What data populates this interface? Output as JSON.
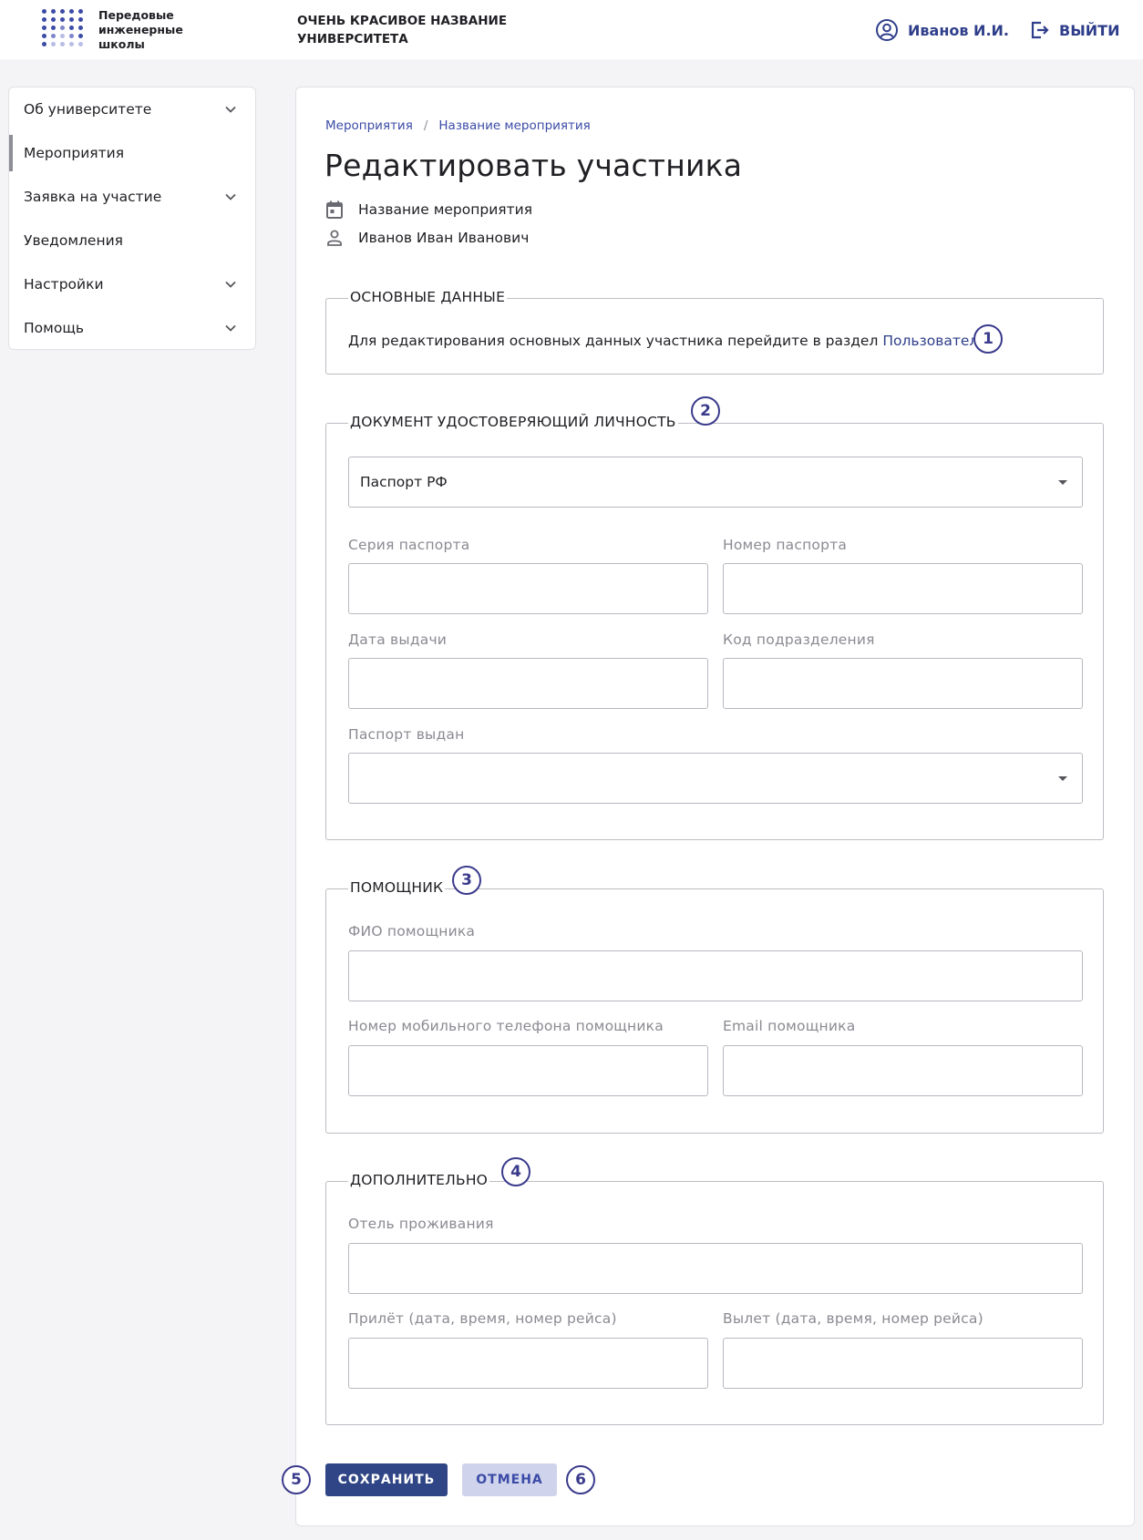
{
  "header": {
    "logo_lines": [
      "Передовые",
      "инженерные",
      "школы"
    ],
    "university_lines": [
      "ОЧЕНЬ КРАСИВОЕ НАЗВАНИЕ",
      "УНИВЕРСИТЕТА"
    ],
    "user_name": "Иванов И.И.",
    "logout_label": "ВЫЙТИ"
  },
  "sidebar": {
    "items": [
      {
        "label": "Об университете",
        "has_children": true
      },
      {
        "label": "Мероприятия",
        "has_children": false,
        "active": true
      },
      {
        "label": "Заявка на участие",
        "has_children": true
      },
      {
        "label": "Уведомления",
        "has_children": false
      },
      {
        "label": "Настройки",
        "has_children": true
      },
      {
        "label": "Помощь",
        "has_children": true
      }
    ]
  },
  "breadcrumb": [
    "Мероприятия",
    "Название мероприятия"
  ],
  "page": {
    "title": "Редактировать участника",
    "event_name": "Название мероприятия",
    "participant_name": "Иванов Иван Иванович"
  },
  "sections": {
    "basic": {
      "legend": "ОСНОВНЫЕ ДАННЫЕ",
      "text": "Для редактирования основных данных участника перейдите в раздел",
      "link": "Пользователи",
      "badge": "1"
    },
    "document": {
      "legend": "ДОКУМЕНТ УДОСТОВЕРЯЮЩИЙ ЛИЧНОСТЬ",
      "badge": "2",
      "doc_type_value": "Паспорт РФ",
      "series_label": "Серия паспорта",
      "number_label": "Номер паспорта",
      "issue_date_label": "Дата выдачи",
      "dept_code_label": "Код подразделения",
      "issued_by_label": "Паспорт выдан"
    },
    "assistant": {
      "legend": "ПОМОЩНИК",
      "badge": "3",
      "name_label": "ФИО помощника",
      "phone_label": "Номер мобильного телефона помощника",
      "email_label": "Email помощника"
    },
    "extra": {
      "legend": "ДОПОЛНИТЕЛЬНО",
      "badge": "4",
      "hotel_label": "Отель проживания",
      "arrival_label": "Прилёт (дата, время, номер рейса)",
      "departure_label": "Вылет (дата, время, номер рейса)"
    }
  },
  "actions": {
    "save_label": "СОХРАНИТЬ",
    "cancel_label": "ОТМЕНА",
    "save_badge": "5",
    "cancel_badge": "6"
  },
  "colors": {
    "accent": "#2f3e8a",
    "primary_button": "#2f4585",
    "secondary_button": "#cfd3ec",
    "badge": "#3a3a8c"
  }
}
